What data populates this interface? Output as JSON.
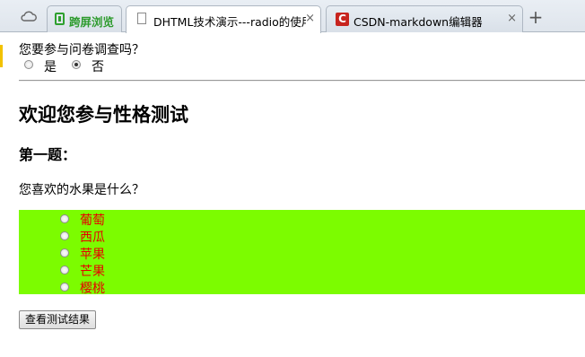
{
  "browser": {
    "tabs": [
      {
        "label": "跨屏浏览",
        "icon": "cross-screen-icon"
      },
      {
        "label": "DHTML技术演示---radio的使用",
        "icon": "page-icon",
        "active": true
      },
      {
        "label": "CSDN-markdown编辑器",
        "icon": "csdn-icon"
      }
    ],
    "close_glyph": "×",
    "new_tab_glyph": "+"
  },
  "survey": {
    "question": "您要参与问卷调查吗？",
    "options": [
      {
        "label": "是",
        "checked": false
      },
      {
        "label": "否",
        "checked": true
      }
    ]
  },
  "page": {
    "title": "欢迎您参与性格测试",
    "section": "第一题：",
    "question": "您喜欢的水果是什么？",
    "fruits": [
      "葡萄",
      "西瓜",
      "苹果",
      "芒果",
      "樱桃"
    ],
    "fruit_box_color": "#7cfc00",
    "fruit_text_color": "#e60000",
    "result_button": "查看测试结果"
  }
}
